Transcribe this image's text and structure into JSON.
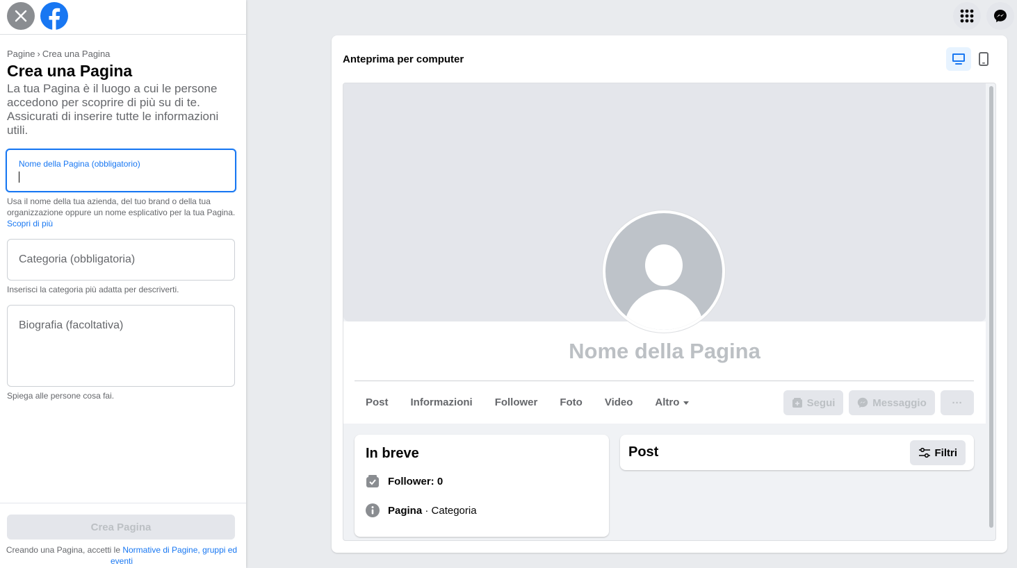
{
  "left_panel": {
    "breadcrumb": {
      "root": "Pagine",
      "separator": "›",
      "current": "Crea una Pagina"
    },
    "title": "Crea una Pagina",
    "description": "La tua Pagina è il luogo a cui le persone accedono per scoprire di più su di te. Assicurati di inserire tutte le informazioni utili.",
    "name_field": {
      "label": "Nome della Pagina (obbligatorio)",
      "value": ""
    },
    "name_help": "Usa il nome della tua azienda, del tuo brand o della tua organizzazione oppure un nome esplicativo per la tua Pagina.",
    "name_help_link": "Scopri di più",
    "category_field": {
      "placeholder": "Categoria (obbligatoria)"
    },
    "category_help": "Inserisci la categoria più adatta per descriverti.",
    "bio_field": {
      "placeholder": "Biografia (facoltativa)"
    },
    "bio_help": "Spiega alle persone cosa fai.",
    "create_button": "Crea Pagina",
    "terms_prefix": "Creando una Pagina, accetti le",
    "terms_link": "Normative di Pagine, gruppi ed eventi"
  },
  "icons": {
    "close": "close-icon",
    "logo": "facebook-logo",
    "menu": "grid-menu-icon",
    "messenger": "messenger-icon",
    "desktop": "desktop-icon",
    "mobile": "mobile-icon"
  },
  "colors": {
    "accent": "#1877f2",
    "disabled_text": "#bcc0c4",
    "secondary_text": "#65676b"
  },
  "preview": {
    "title": "Anteprima per computer",
    "page_name": "Nome della Pagina",
    "tabs": [
      "Post",
      "Informazioni",
      "Follower",
      "Foto",
      "Video",
      "Altro"
    ],
    "buttons": {
      "follow": "Segui",
      "message": "Messaggio",
      "more": "···"
    },
    "intro": {
      "title": "In breve",
      "followers": "Follower: 0",
      "page_label": "Pagina",
      "page_category": "· Categoria"
    },
    "posts": {
      "title": "Post",
      "filter": "Filtri"
    }
  }
}
